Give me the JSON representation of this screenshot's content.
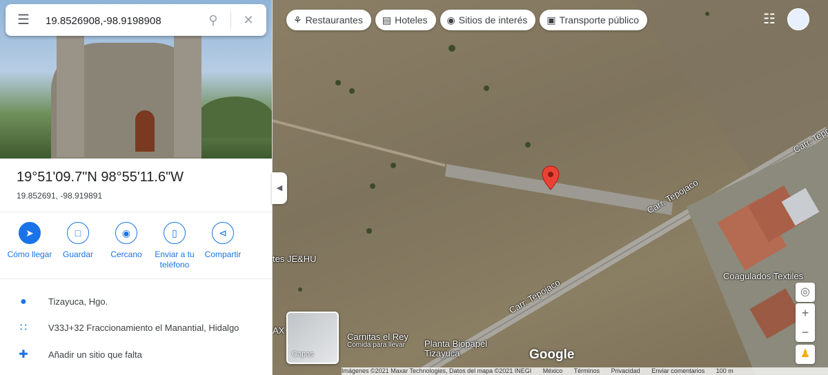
{
  "search": {
    "query": "19.8526908,-98.9198908"
  },
  "place": {
    "title": "19°51'09.7\"N 98°55'11.6\"W",
    "decimal": "19.852691, -98.919891"
  },
  "actions": [
    {
      "label": "Cómo llegar",
      "icon": "directions-icon"
    },
    {
      "label": "Guardar",
      "icon": "bookmark-icon"
    },
    {
      "label": "Cercano",
      "icon": "nearby-icon"
    },
    {
      "label": "Enviar a tu teléfono",
      "icon": "send-to-phone-icon"
    },
    {
      "label": "Compartir",
      "icon": "share-icon"
    }
  ],
  "info": {
    "locality": "Tizayuca, Hgo.",
    "pluscode": "V33J+32 Fraccionamiento el Manantial, Hidalgo",
    "add_place": "Añadir un sitio que falta"
  },
  "categories": [
    {
      "label": "Restaurantes",
      "icon": "fork-knife-icon"
    },
    {
      "label": "Hoteles",
      "icon": "bed-icon"
    },
    {
      "label": "Sitios de interés",
      "icon": "camera-icon"
    },
    {
      "label": "Transporte público",
      "icon": "bus-icon"
    }
  ],
  "map": {
    "road_upper": "Carr. Tepojaco",
    "road_lower": "Carr. Tepojaco",
    "road_edge": "Carr. Tepo",
    "poi_jehu": "tes JE&HU",
    "poi_coagulados": "Coagulados Textiles",
    "poi_carnitas": "Carnitas el Rey",
    "poi_carnitas_sub": "Comida para llevar",
    "poi_planta_1": "Planta Biopapel",
    "poi_planta_2": "Tizayuca",
    "edge_label": "AX",
    "layers_label": "Capas",
    "google": "Google",
    "pin_color": "#ea4335"
  },
  "footer": {
    "imagery": "Imágenes ©2021 Maxar Technologies, Datos del mapa ©2021 INEGI",
    "country": "México",
    "terms": "Términos",
    "privacy": "Privacidad",
    "feedback": "Enviar comentarios",
    "scale": "100 m"
  }
}
